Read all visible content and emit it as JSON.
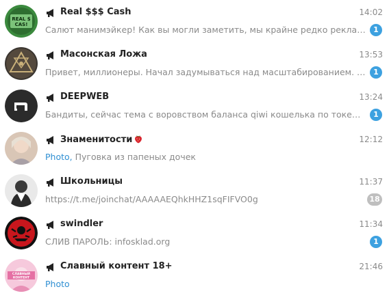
{
  "chats": [
    {
      "title": "Real $$$ Cash",
      "time": "14:02",
      "preview": "Салют манимэйкер!  Как вы могли заметить, мы крайне редко рекламир…",
      "media_prefix": "",
      "unread": "1",
      "muted": false,
      "avatar": "money-avatar",
      "avatar_text": "REAL $ CAS!"
    },
    {
      "title": "Масонская Ложа",
      "time": "13:53",
      "preview": "Привет, миллионеры. Начал задумываться над масштабированием. Поду…",
      "media_prefix": "",
      "unread": "1",
      "muted": false,
      "avatar": "masonic-avatar"
    },
    {
      "title": "DEEPWEB",
      "time": "13:24",
      "preview": "Бандиты, сейчас тема с воровством баланса qiwi кошелька по токену нах…",
      "media_prefix": "",
      "unread": "1",
      "muted": false,
      "avatar": "deepweb-avatar"
    },
    {
      "title": "Знаменитости",
      "time": "12:12",
      "preview": "Пуговка из папеных дочек",
      "media_prefix": "Photo, ",
      "unread": "",
      "muted": false,
      "avatar": "celebrity-avatar",
      "title_emoji": "strawberry"
    },
    {
      "title": "Школьницы",
      "time": "11:37",
      "preview": "https://t.me/joinchat/AAAAAEQhkHHZ1sqFIFVO0g",
      "media_prefix": "",
      "unread": "18",
      "muted": true,
      "avatar": "schoolgirls-avatar"
    },
    {
      "title": "swindler",
      "time": "11:34",
      "preview": "СЛИВ ПАРОЛЬ: infosklad.org",
      "media_prefix": "",
      "unread": "1",
      "muted": false,
      "avatar": "swindler-avatar"
    },
    {
      "title": "Славный контент 18+",
      "time": "21:46",
      "preview": "",
      "media_prefix": "Photo",
      "unread": "",
      "muted": false,
      "avatar": "content-avatar",
      "avatar_text": "СЛАВНЫЙ КОНТЕНТ"
    }
  ],
  "colors": {
    "badge": "#3da1e0",
    "badge_muted": "#bfbfbf",
    "media_link": "#2f8fd3"
  }
}
